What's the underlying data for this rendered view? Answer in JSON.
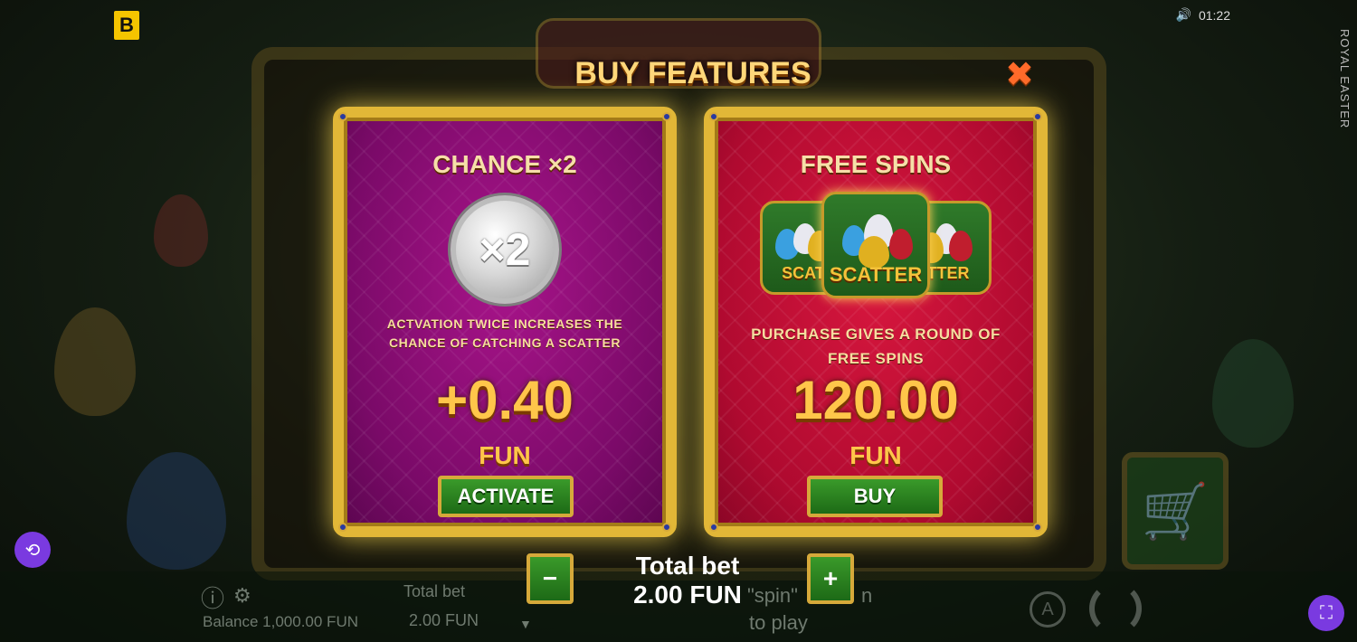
{
  "brand": {
    "logo_letter": "B"
  },
  "status": {
    "time": "01:22",
    "sound_icon": "speaker-icon"
  },
  "game": {
    "vertical_title": "ROYAL EASTER"
  },
  "dialog": {
    "title": "BUY FEATURES",
    "close_icon": "close-icon",
    "cards": [
      {
        "title": "CHANCE ×2",
        "badge": "×2",
        "description": "ACTVATION TWICE INCREASES THE CHANCE OF CATCHING A SCATTER",
        "price": "+0.40",
        "currency": "FUN",
        "button": "ACTIVATE"
      },
      {
        "title": "FREE SPINS",
        "scatter_left": "SCAT",
        "scatter_center": "SCATTER",
        "scatter_right": "TTER",
        "description": "PURCHASE GIVES A ROUND OF FREE SPINS",
        "price": "120.00",
        "currency": "FUN",
        "button": "BUY"
      }
    ]
  },
  "bet": {
    "label": "Total bet",
    "value": "2.00 FUN",
    "minus": "−",
    "plus": "+"
  },
  "bottom": {
    "info_icon": "info-icon",
    "settings_icon": "gear-icon",
    "balance": "Balance 1,000.00 FUN",
    "total_bet_label": "Total bet",
    "total_bet_value": "2.00 FUN",
    "spin_hint_1": "\"spin\"",
    "spin_hint_2": "n",
    "spin_hint_3": "to play",
    "auto_label": "A"
  },
  "colors": {
    "gold": "#e2b737",
    "left_card": "#a8148a",
    "right_card": "#d8173e",
    "button_green": "#3a9a2a",
    "price": "#ffc64a",
    "purple": "#7a3ae0"
  }
}
